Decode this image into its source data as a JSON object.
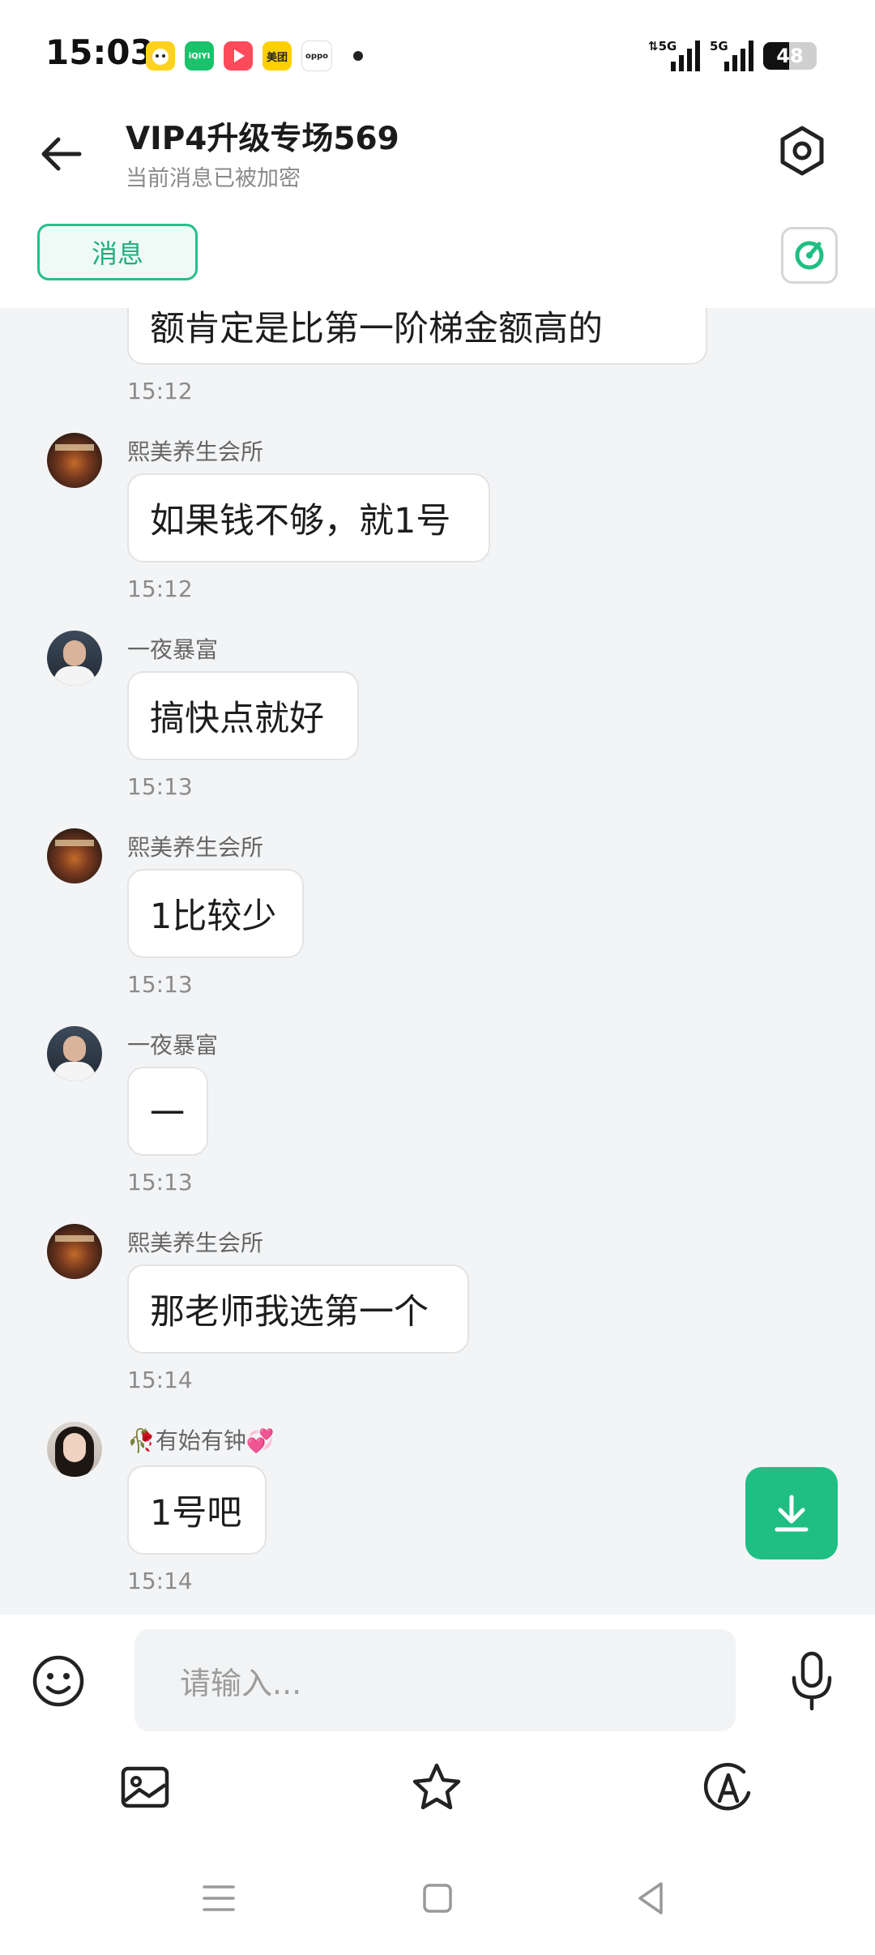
{
  "status_bar": {
    "time": "15:03",
    "battery": "48",
    "battery_level": 0.48,
    "notification_apps": [
      "app-1",
      "iqiyi",
      "video",
      "meituan",
      "oppo"
    ],
    "app_texts": {
      "iqiyi": "iQIYI",
      "meituan": "美团",
      "oppo": "oppo"
    }
  },
  "header": {
    "title": "VIP4升级专场569",
    "subtitle": "当前消息已被加密",
    "tab_label": "消息"
  },
  "messages": [
    {
      "type": "partial",
      "text": "额肯定是比第一阶梯金额高的",
      "time": "15:12"
    },
    {
      "sender": "熙美养生会所",
      "avatar": "shop",
      "text": "如果钱不够，就1号",
      "time": "15:12"
    },
    {
      "sender": "一夜暴富",
      "avatar": "man",
      "text": "搞快点就好",
      "time": "15:13"
    },
    {
      "sender": "熙美养生会所",
      "avatar": "shop",
      "text": "1比较少",
      "time": "15:13"
    },
    {
      "sender": "一夜暴富",
      "avatar": "man",
      "text": "一",
      "time": "15:13"
    },
    {
      "sender": "熙美养生会所",
      "avatar": "shop",
      "text": "那老师我选第一个",
      "time": "15:14"
    },
    {
      "sender": "🥀有始有钟💞",
      "avatar": "woman",
      "text": "1号吧",
      "time": "15:14"
    }
  ],
  "composer": {
    "placeholder": "请输入..."
  },
  "colors": {
    "accent": "#1fbf83",
    "background": "#f3f4f6"
  }
}
